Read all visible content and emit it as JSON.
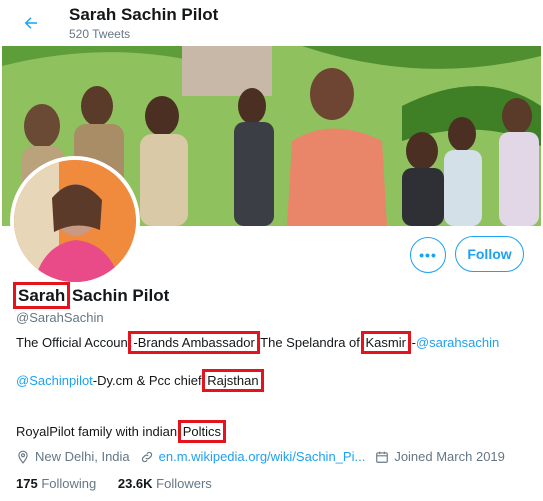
{
  "header": {
    "name": "Sarah Sachin Pilot",
    "tweet_count": "520 Tweets"
  },
  "profile": {
    "more_label": "•••",
    "follow_label": "Follow",
    "name_first": "Sarah",
    "name_rest": " Sachin Pilot",
    "handle": "@SarahSachin"
  },
  "bio": {
    "line1_a": "The Official Account",
    "line1_b": "-Brands Ambassador",
    "line1_c": "  The Spelandra of ",
    "line1_d": "Kasmir",
    "line1_e": " -",
    "line1_f": "@sarahsachin",
    "line2_a": "@Sachinpilot",
    "line2_b": "-Dy.cm & Pcc chief ",
    "line2_c": "Rajsthan",
    "line3_a": "RoyalPilot family with indian ",
    "line3_b": "Poltics"
  },
  "meta": {
    "location": "New Delhi, India",
    "link": "en.m.wikipedia.org/wiki/Sachin_Pi...",
    "joined": "Joined March 2019"
  },
  "stats": {
    "following_count": "175",
    "following_label": " Following",
    "followers_count": "23.6K",
    "followers_label": " Followers"
  },
  "colors": {
    "accent": "#1da1f2",
    "highlight_box": "#e3141e"
  },
  "icons": [
    "back-arrow-icon",
    "location-pin-icon",
    "link-icon",
    "calendar-icon"
  ]
}
